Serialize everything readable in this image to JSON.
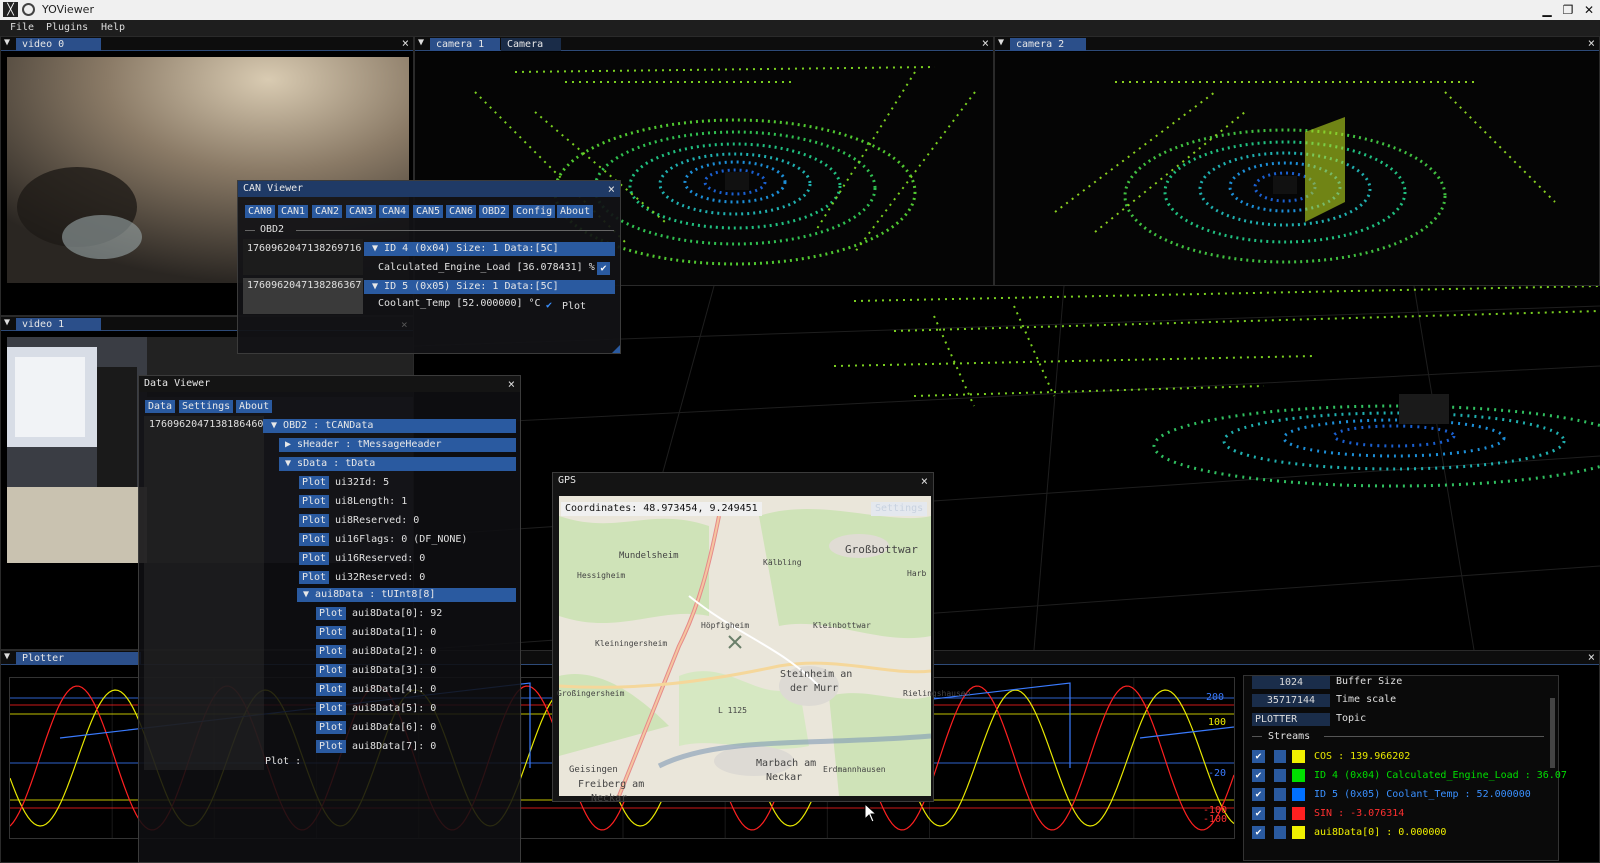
{
  "app": {
    "title": "YOViewer",
    "menu": [
      "File",
      "Plugins",
      "Help"
    ]
  },
  "video0": {
    "tab": "video 0"
  },
  "video1": {
    "tab": "video 1"
  },
  "camera1": {
    "tabs": [
      "camera 1",
      "Camera"
    ]
  },
  "camera2": {
    "tab": "camera 2"
  },
  "plotter": {
    "tab": "Plotter",
    "ticks_right": [
      "200",
      "100",
      "-20",
      "-100",
      "-100"
    ],
    "settings": {
      "buffer_size_value": "1024",
      "buffer_size_label": "Buffer Size",
      "time_scale_value": "35717144",
      "time_scale_label": "Time scale",
      "topic_value": "PLOTTER",
      "topic_label": "Topic",
      "streams_header": "Streams"
    },
    "streams": [
      {
        "color": "#f0f000",
        "text": "COS : 139.966202",
        "text_color": "#e8e800"
      },
      {
        "color": "#00e000",
        "text": "ID 4 (0x04) Calculated_Engine_Load : 36.07",
        "text_color": "#00e000"
      },
      {
        "color": "#0070ff",
        "text": "ID 5 (0x05) Coolant_Temp : 52.000000",
        "text_color": "#3a90ff"
      },
      {
        "color": "#ff2020",
        "text": "SIN : -3.076314",
        "text_color": "#ff3030"
      },
      {
        "color": "#f0f000",
        "text": "aui8Data[0] : 0.000000",
        "text_color": "#f0f000"
      }
    ]
  },
  "can_viewer": {
    "title": "CAN Viewer",
    "tabs": [
      "CAN0",
      "CAN1",
      "CAN2",
      "CAN3",
      "CAN4",
      "CAN5",
      "CAN6",
      "OBD2",
      "Config",
      "About"
    ],
    "section": "OBD2",
    "rows": [
      {
        "timestamp": "1760962047138269716",
        "header": "ID 4 (0x04)   Size: 1   Data:[5C]",
        "signal": "Calculated_Engine_Load [36.078431] %"
      },
      {
        "timestamp": "1760962047138286367",
        "header": "ID 5 (0x05)   Size: 1   Data:[5C]",
        "signal": "Coolant_Temp [52.000000] °C",
        "plot_label": "Plot"
      }
    ]
  },
  "data_viewer": {
    "title": "Data Viewer",
    "tabs": [
      "Data",
      "Settings",
      "About"
    ],
    "timestamp": "1760962047138186460",
    "root": "OBD2 : tCANData",
    "sheader": "sHeader : tMessageHeader",
    "sdata": "sData : tData",
    "plot_label": "Plot",
    "fields": [
      "ui32Id: 5",
      "ui8Length: 1",
      "ui8Reserved: 0",
      "ui16Flags: 0 (DF_NONE)",
      "ui16Reserved: 0",
      "ui32Reserved: 0"
    ],
    "array_header": "aui8Data : tUInt8[8]",
    "array_items": [
      "aui8Data[0]: 92",
      "aui8Data[1]: 0",
      "aui8Data[2]: 0",
      "aui8Data[3]: 0",
      "aui8Data[4]: 0",
      "aui8Data[5]: 0",
      "aui8Data[6]: 0",
      "aui8Data[7]: 0"
    ],
    "footer": "Plot :"
  },
  "gps": {
    "title": "GPS",
    "coordinates": "Coordinates: 48.973454, 9.249451",
    "settings": "Settings",
    "places": [
      "Großbottwar",
      "Mundelsheim",
      "Hessigheim",
      "Kälbling",
      "Höpfigheim",
      "Kleinbottwar",
      "Kleiningersheim",
      "Steinheim an",
      "der Murr",
      "Großingersheim",
      "L 1125",
      "Rielingshausen",
      "Marbach am",
      "Neckar",
      "Erdmannhausen",
      "Geisingen",
      "Freiberg am",
      "Neckar",
      "Harb"
    ]
  },
  "colors": {
    "accent": "#2a5aa0",
    "title_active": "#1f3a66"
  }
}
